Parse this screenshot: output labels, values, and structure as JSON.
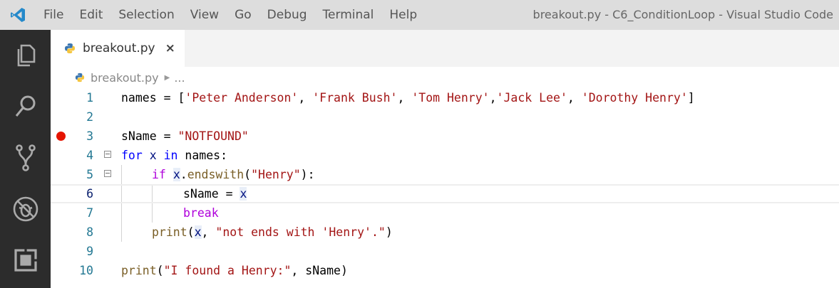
{
  "titlebar": {
    "menu": [
      "File",
      "Edit",
      "Selection",
      "View",
      "Go",
      "Debug",
      "Terminal",
      "Help"
    ],
    "window_title": "breakout.py - C6_ConditionLoop - Visual Studio Code"
  },
  "activity_bar": {
    "icons": [
      "explorer-icon",
      "search-icon",
      "source-control-icon",
      "debug-icon",
      "extensions-icon"
    ]
  },
  "tabs": [
    {
      "label": "breakout.py",
      "close": "×"
    }
  ],
  "breadcrumb": {
    "file": "breakout.py",
    "chevron": "▶",
    "more": "..."
  },
  "editor": {
    "line_numbers": [
      "1",
      "2",
      "3",
      "4",
      "5",
      "6",
      "7",
      "8",
      "9",
      "10"
    ],
    "breakpoint_line": "3",
    "current_line": "6",
    "folded_lines": [
      "4",
      "5"
    ],
    "lines": {
      "l1": {
        "a": "names = [",
        "s1": "'Peter Anderson'",
        "c1": ", ",
        "s2": "'Frank Bush'",
        "c2": ", ",
        "s3": "'Tom Henry'",
        "c3": ",",
        "s4": "'Jack Lee'",
        "c4": ", ",
        "s5": "'Dorothy Henry'",
        "end": "]"
      },
      "l3": {
        "a": "sName = ",
        "s": "\"NOTFOUND\""
      },
      "l4": {
        "kw1": "for",
        "sp1": " ",
        "x": "x",
        "sp2": " ",
        "kw2": "in",
        "rest": " names:"
      },
      "l5": {
        "kw": "if",
        "sp": " ",
        "x": "x",
        "dot": ".",
        "fn": "endswith",
        "p": "(",
        "s": "\"Henry\"",
        "end": "):"
      },
      "l6": {
        "a": "sName = ",
        "x": "x"
      },
      "l7": {
        "kw": "break"
      },
      "l8": {
        "fn": "print",
        "p": "(",
        "x": "x",
        "c": ", ",
        "s": "\"not ends with 'Henry'.\"",
        "end": ")"
      },
      "l10": {
        "fn": "print",
        "p": "(",
        "s": "\"I found a Henry:\"",
        "c": ", sName",
        "end": ")"
      }
    }
  },
  "colors": {
    "titlebar_bg": "#dddddd",
    "activitybar_bg": "#2c2c2c",
    "breakpoint": "#e51400",
    "string": "#a31515",
    "keyword": "#0000ff",
    "control": "#af00db",
    "function": "#795e26",
    "line_number": "#237893",
    "vscode_blue": "#007acc"
  }
}
